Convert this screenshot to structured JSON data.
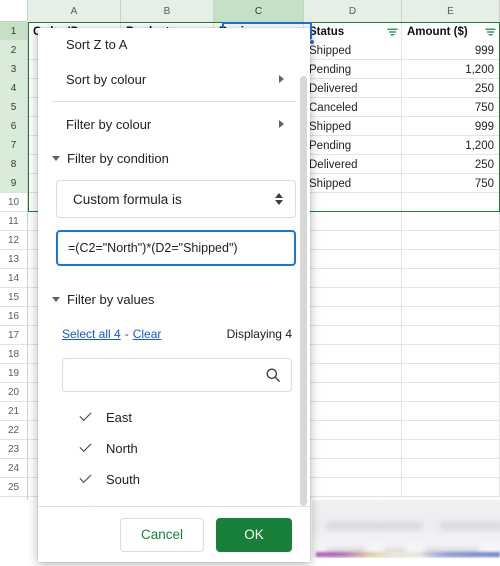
{
  "spreadsheet": {
    "column_letters": [
      "A",
      "B",
      "C",
      "D",
      "E"
    ],
    "selected_column_letter": "C",
    "row_numbers": [
      "1",
      "2",
      "3",
      "4",
      "5",
      "6",
      "7",
      "8",
      "9",
      "10",
      "11",
      "12",
      "13",
      "14",
      "15",
      "16",
      "17",
      "18",
      "19",
      "20",
      "21",
      "22",
      "23",
      "24",
      "25"
    ],
    "headers": [
      "Order ID",
      "Product",
      "Region",
      "Status",
      "Amount ($)"
    ],
    "rows": [
      {
        "status": "Shipped",
        "amount": "999"
      },
      {
        "status": "Pending",
        "amount": "1,200"
      },
      {
        "status": "Delivered",
        "amount": "250"
      },
      {
        "status": "Canceled",
        "amount": "750"
      },
      {
        "status": "Shipped",
        "amount": "999"
      },
      {
        "status": "Pending",
        "amount": "1,200"
      },
      {
        "status": "Delivered",
        "amount": "250"
      },
      {
        "status": "Shipped",
        "amount": "750"
      }
    ],
    "colors": {
      "header_green": "#c6e0c6",
      "column_head_green": "#e6efe6",
      "selection_blue": "#1a73e8",
      "range_green": "#188038"
    }
  },
  "filter_panel": {
    "menu": [
      {
        "label": "Sort Z to A",
        "has_submenu": false
      },
      {
        "label": "Sort by colour",
        "has_submenu": true
      },
      {
        "label": "Filter by colour",
        "has_submenu": true
      }
    ],
    "filter_by_condition": {
      "label": "Filter by condition",
      "expanded": true,
      "selected_option": "Custom formula is",
      "formula_value": "=(C2=\"North\")*(D2=\"Shipped\")"
    },
    "filter_by_values": {
      "label": "Filter by values",
      "expanded": true,
      "select_all_label": "Select all 4",
      "separator": "-",
      "clear_label": "Clear",
      "displaying_label": "Displaying 4",
      "search_placeholder": "",
      "search_value": "",
      "items": [
        {
          "label": "East",
          "checked": true
        },
        {
          "label": "North",
          "checked": true
        },
        {
          "label": "South",
          "checked": true
        },
        {
          "label": "West",
          "checked": true
        }
      ]
    },
    "buttons": {
      "cancel_label": "Cancel",
      "ok_label": "OK"
    }
  }
}
